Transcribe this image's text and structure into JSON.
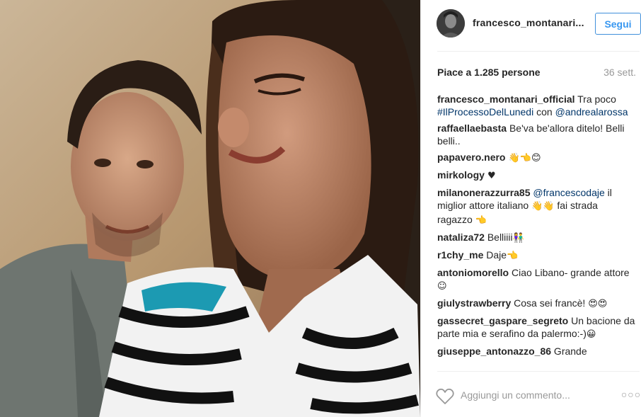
{
  "header": {
    "username": "francesco_montanari...",
    "follow_label": "Segui"
  },
  "stats": {
    "likes": "Piace a 1.285 persone",
    "age": "36 sett."
  },
  "comments": [
    {
      "author": "francesco_montanari_official",
      "parts": [
        {
          "text": " Tra poco ",
          "type": "text"
        },
        {
          "text": "#IlProcessoDelLunedi",
          "type": "tag"
        },
        {
          "text": " con ",
          "type": "text"
        },
        {
          "text": "@andrealarossa",
          "type": "tag"
        }
      ]
    },
    {
      "author": "raffaellaebasta",
      "parts": [
        {
          "text": " Be'va be'allora ditelo! Belli belli..",
          "type": "text"
        }
      ]
    },
    {
      "author": "papavero.nero",
      "parts": [
        {
          "text": " 👋👈😊",
          "type": "emoji"
        }
      ]
    },
    {
      "author": "mirkology",
      "parts": [
        {
          "text": " ♥",
          "type": "emoji"
        }
      ]
    },
    {
      "author": "milanonerazzurra85",
      "parts": [
        {
          "text": " ",
          "type": "text"
        },
        {
          "text": "@francescodaje",
          "type": "tag"
        },
        {
          "text": " il miglior attore italiano ",
          "type": "text"
        },
        {
          "text": "👋👋",
          "type": "emoji"
        },
        {
          "text": " fai strada ragazzo ",
          "type": "text"
        },
        {
          "text": "👈",
          "type": "emoji"
        }
      ]
    },
    {
      "author": "nataliza72",
      "parts": [
        {
          "text": " Belliiii",
          "type": "text"
        },
        {
          "text": "👫",
          "type": "emoji"
        }
      ]
    },
    {
      "author": "r1chy_me",
      "parts": [
        {
          "text": " Daje",
          "type": "text"
        },
        {
          "text": "👈",
          "type": "emoji"
        }
      ]
    },
    {
      "author": "antoniomorello",
      "parts": [
        {
          "text": " Ciao Libano- grande attore ",
          "type": "text"
        },
        {
          "text": "☺",
          "type": "emoji"
        }
      ]
    },
    {
      "author": "giulystrawberry",
      "parts": [
        {
          "text": " Cosa sei francè! ",
          "type": "text"
        },
        {
          "text": "😍😍",
          "type": "emoji"
        }
      ]
    },
    {
      "author": "gassecret_gaspare_segreto",
      "parts": [
        {
          "text": " Un bacione da parte mia e serafino da palermo:-)",
          "type": "text"
        },
        {
          "text": "😀",
          "type": "emoji"
        }
      ]
    },
    {
      "author": "giuseppe_antonazzo_86",
      "parts": [
        {
          "text": " Grande",
          "type": "text"
        }
      ]
    }
  ],
  "footer": {
    "comment_placeholder": "Aggiungi un commento...",
    "more_label": "○○○"
  },
  "icons": {
    "like": "heart-outline-icon",
    "more": "more-options-icon"
  },
  "colors": {
    "follow_blue": "#3897f0",
    "tag_blue": "#003569",
    "muted_gray": "#999999"
  }
}
